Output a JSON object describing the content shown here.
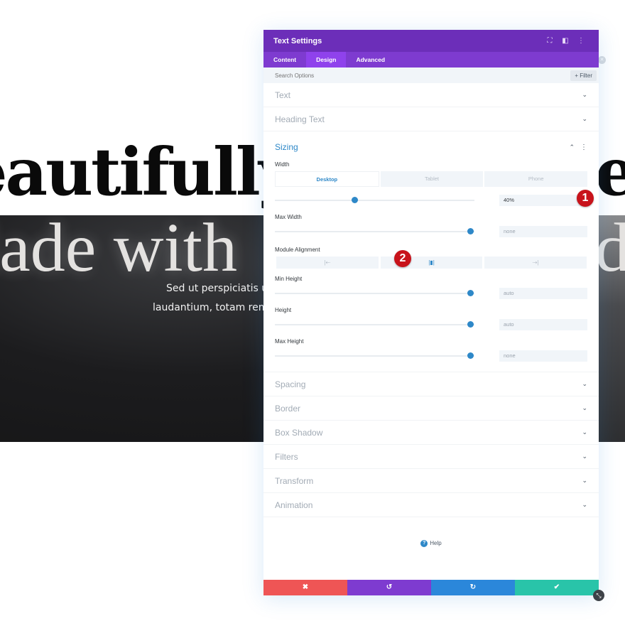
{
  "background": {
    "headline_line1": "eautifully",
    "headline_line1_right": "eb",
    "headline_line2": "lade with",
    "headline_line2_right": "di",
    "body_line1": "Sed ut perspiciatis und",
    "body_line2": "laudantium, totam rem a"
  },
  "panel": {
    "title": "Text Settings",
    "header_icons": [
      "fullscreen-icon",
      "split-view-icon",
      "more-options-icon"
    ],
    "tabs": [
      {
        "label": "Content",
        "active": false
      },
      {
        "label": "Design",
        "active": true
      },
      {
        "label": "Advanced",
        "active": false
      }
    ],
    "search": {
      "placeholder": "Search Options",
      "value": ""
    },
    "filter_label": "+ Filter",
    "collapsed_sections_top": [
      {
        "label": "Text"
      },
      {
        "label": "Heading Text"
      }
    ],
    "sizing": {
      "title": "Sizing",
      "width": {
        "label": "Width",
        "devices": [
          {
            "label": "Desktop",
            "active": true
          },
          {
            "label": "Tablet",
            "active": false
          },
          {
            "label": "Phone",
            "active": false
          }
        ],
        "value": "40%",
        "slider_fraction": 0.4
      },
      "max_width": {
        "label": "Max Width",
        "value": "none",
        "slider_fraction": 0.98
      },
      "module_alignment": {
        "label": "Module Alignment",
        "options": [
          {
            "icon": "align-left-icon",
            "glyph": "|⇠",
            "active": false
          },
          {
            "icon": "align-center-icon",
            "glyph": "|▮|",
            "active": true
          },
          {
            "icon": "align-right-icon",
            "glyph": "⇢|",
            "active": false
          }
        ]
      },
      "min_height": {
        "label": "Min Height",
        "value": "auto",
        "slider_fraction": 0.98
      },
      "height": {
        "label": "Height",
        "value": "auto",
        "slider_fraction": 0.98
      },
      "max_height": {
        "label": "Max Height",
        "value": "none",
        "slider_fraction": 0.98
      }
    },
    "collapsed_sections_bottom": [
      {
        "label": "Spacing"
      },
      {
        "label": "Border"
      },
      {
        "label": "Box Shadow"
      },
      {
        "label": "Filters"
      },
      {
        "label": "Transform"
      },
      {
        "label": "Animation"
      }
    ],
    "help_label": "Help",
    "footer": {
      "cancel": {
        "glyph": "✖",
        "color": "#ef5555"
      },
      "undo": {
        "glyph": "↺",
        "color": "#7e3bd0"
      },
      "redo": {
        "glyph": "↻",
        "color": "#2b87da"
      },
      "save": {
        "glyph": "✔",
        "color": "#29c4a9"
      }
    }
  },
  "annotations": {
    "badge_1": "1",
    "badge_2": "2"
  },
  "colors": {
    "header_purple": "#6c2eb9",
    "tab_purple": "#7e3bd0",
    "active_tab": "#8f42ec",
    "accent_blue": "#2e88c8",
    "badge_red": "#c8131b"
  }
}
